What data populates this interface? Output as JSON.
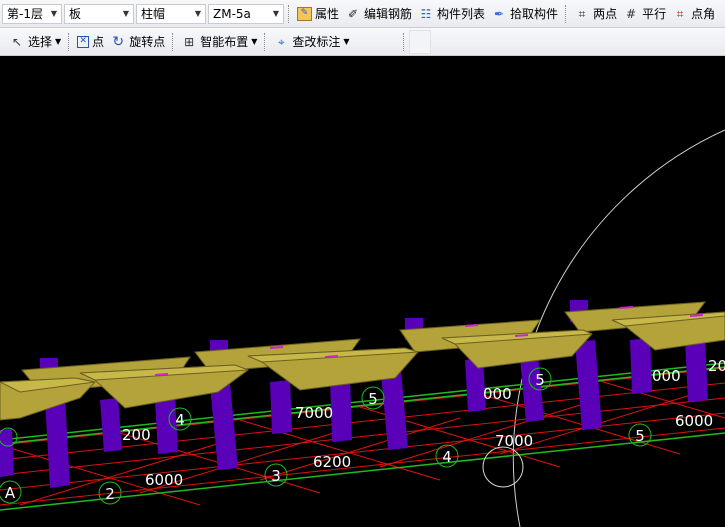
{
  "toolbar1": {
    "floor": "第-1层",
    "category": "板",
    "component_type": "柱帽",
    "component_name": "ZM-5a",
    "properties": "属性",
    "edit_rebar": "编辑钢筋",
    "component_list": "构件列表",
    "pick_component": "拾取构件",
    "two_points": "两点",
    "parallel": "平行",
    "point_angle": "点角"
  },
  "toolbar2": {
    "select": "选择",
    "point": "点",
    "rotate_point": "旋转点",
    "smart_layout": "智能布置",
    "check_annotation": "查改标注"
  },
  "viewport": {
    "dimensions_front": [
      "6000",
      "6200",
      "7000",
      "6000"
    ],
    "dimensions_back": [
      "200",
      "7000",
      "000",
      "000",
      "20"
    ],
    "axis_labels_front": [
      "A",
      "2",
      "3",
      "4",
      "5"
    ],
    "axis_labels_back": [
      "4",
      "5",
      "5"
    ],
    "colors": {
      "column": "#5a00b8",
      "cap": "#b3a33a",
      "grid": "#e01010",
      "guide": "#1fb91f"
    }
  }
}
